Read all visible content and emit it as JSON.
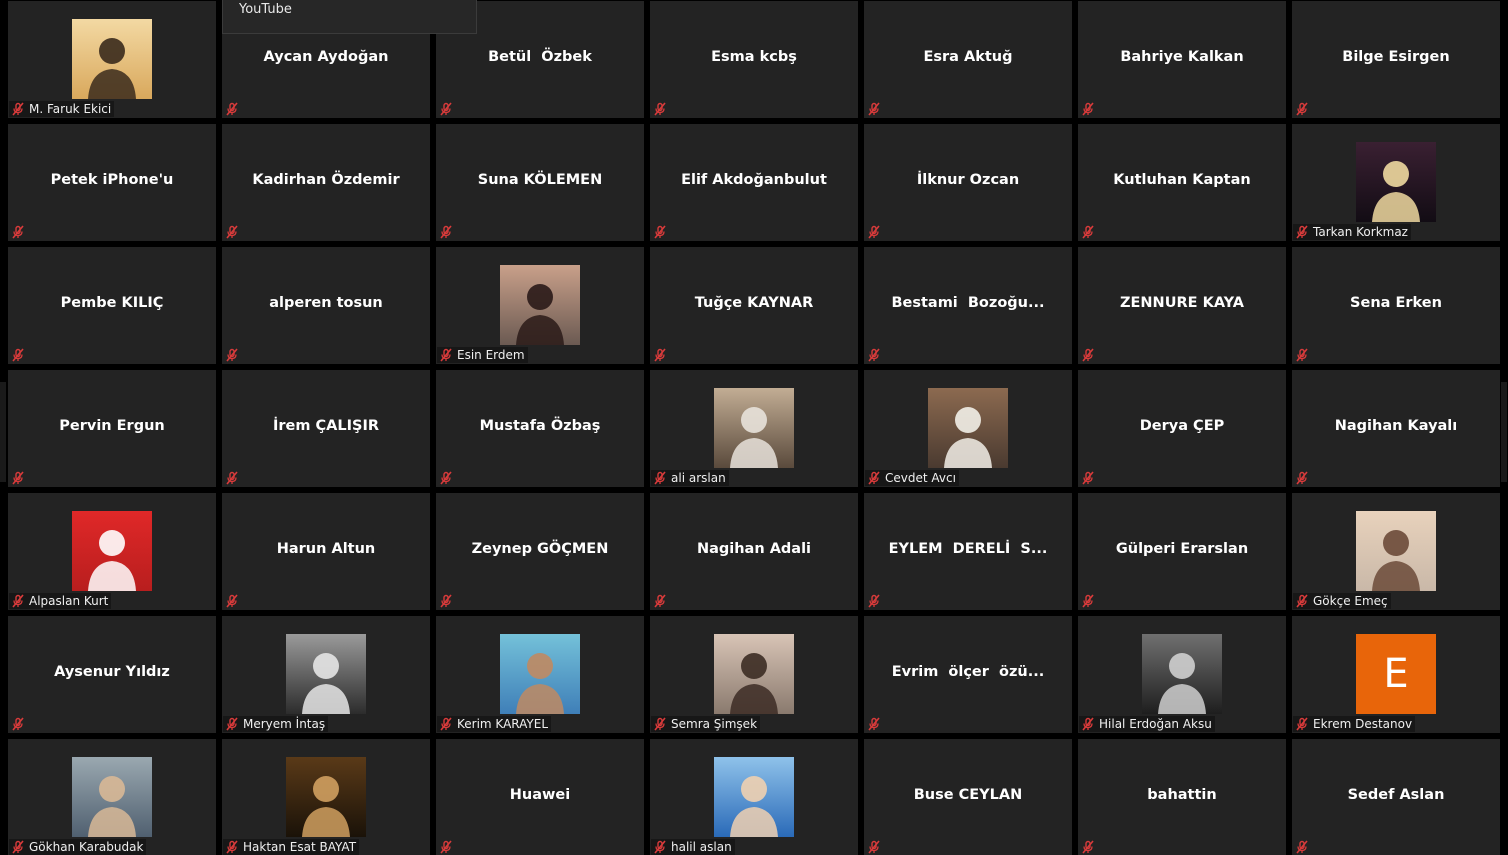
{
  "overlay_menu": {
    "label": "YouTube"
  },
  "colors": {
    "tile_background": "#232323",
    "stage_background": "#000000",
    "mute_icon": "#d93b3b",
    "name_text": "#ffffff"
  },
  "participants": [
    {
      "name": "M. Faruk Ekici",
      "avatar": "photo",
      "label": "M. Faruk Ekici"
    },
    {
      "name": "Aycan Aydoğan",
      "avatar": "none",
      "label": ""
    },
    {
      "name": "Betül  Özbek",
      "avatar": "none",
      "label": ""
    },
    {
      "name": "Esma kcbş",
      "avatar": "none",
      "label": ""
    },
    {
      "name": "Esra Aktuğ",
      "avatar": "none",
      "label": ""
    },
    {
      "name": "Bahriye Kalkan",
      "avatar": "none",
      "label": ""
    },
    {
      "name": "Bilge Esirgen",
      "avatar": "none",
      "label": ""
    },
    {
      "name": "Petek iPhone'u",
      "avatar": "none",
      "label": ""
    },
    {
      "name": "Kadirhan Özdemir",
      "avatar": "none",
      "label": ""
    },
    {
      "name": "Suna KÖLEMEN",
      "avatar": "none",
      "label": ""
    },
    {
      "name": "Elif Akdoğanbulut",
      "avatar": "none",
      "label": ""
    },
    {
      "name": "İlknur Ozcan",
      "avatar": "none",
      "label": ""
    },
    {
      "name": "Kutluhan Kaptan",
      "avatar": "none",
      "label": ""
    },
    {
      "name": "Tarkan Korkmaz",
      "avatar": "photo",
      "label": "Tarkan Korkmaz"
    },
    {
      "name": "Pembe KILIÇ",
      "avatar": "none",
      "label": ""
    },
    {
      "name": "alperen tosun",
      "avatar": "none",
      "label": ""
    },
    {
      "name": "Esin Erdem",
      "avatar": "photo",
      "label": "Esin Erdem"
    },
    {
      "name": "Tuğçe KAYNAR",
      "avatar": "none",
      "label": ""
    },
    {
      "name": "Bestami  Bozoğu...",
      "avatar": "none",
      "label": ""
    },
    {
      "name": "ZENNURE KAYA",
      "avatar": "none",
      "label": ""
    },
    {
      "name": "Sena Erken",
      "avatar": "none",
      "label": ""
    },
    {
      "name": "Pervin Ergun",
      "avatar": "none",
      "label": ""
    },
    {
      "name": "İrem ÇALIŞIR",
      "avatar": "none",
      "label": ""
    },
    {
      "name": "Mustafa Özbaş",
      "avatar": "none",
      "label": ""
    },
    {
      "name": "ali arslan",
      "avatar": "photo",
      "label": "ali arslan"
    },
    {
      "name": "Cevdet Avcı",
      "avatar": "photo",
      "label": "Cevdet Avcı"
    },
    {
      "name": "Derya ÇEP",
      "avatar": "none",
      "label": ""
    },
    {
      "name": "Nagihan Kayalı",
      "avatar": "none",
      "label": ""
    },
    {
      "name": "Alpaslan Kurt",
      "avatar": "photo",
      "label": "Alpaslan Kurt"
    },
    {
      "name": "Harun Altun",
      "avatar": "none",
      "label": ""
    },
    {
      "name": "Zeynep GÖÇMEN",
      "avatar": "none",
      "label": ""
    },
    {
      "name": "Nagihan Adali",
      "avatar": "none",
      "label": ""
    },
    {
      "name": "EYLEM  DERELİ  S...",
      "avatar": "none",
      "label": ""
    },
    {
      "name": "Gülperi Erarslan",
      "avatar": "none",
      "label": ""
    },
    {
      "name": "Gökçe Emeç",
      "avatar": "photo",
      "label": "Gökçe Emeç"
    },
    {
      "name": "Aysenur Yıldız",
      "avatar": "none",
      "label": ""
    },
    {
      "name": "Meryem İntaş",
      "avatar": "photo",
      "label": "Meryem İntaş"
    },
    {
      "name": "Kerim KARAYEL",
      "avatar": "photo",
      "label": "Kerim KARAYEL"
    },
    {
      "name": "Semra Şimşek",
      "avatar": "photo",
      "label": "Semra Şimşek"
    },
    {
      "name": "Evrim  ölçer  özü...",
      "avatar": "none",
      "label": ""
    },
    {
      "name": "Hilal Erdoğan Aksu",
      "avatar": "photo",
      "label": "Hilal Erdoğan Aksu"
    },
    {
      "name": "Ekrem Destanov",
      "avatar": "initial",
      "initial": "E",
      "initial_color": "#e8650a",
      "label": "Ekrem Destanov"
    },
    {
      "name": "Gökhan Karabudak",
      "avatar": "photo",
      "label": "Gökhan Karabudak"
    },
    {
      "name": "Haktan Esat BAYAT",
      "avatar": "photo",
      "label": "Haktan Esat BAYAT"
    },
    {
      "name": "Huawei",
      "avatar": "none",
      "label": ""
    },
    {
      "name": "halil aslan",
      "avatar": "photo",
      "label": "halil aslan"
    },
    {
      "name": "Buse CEYLAN",
      "avatar": "none",
      "label": ""
    },
    {
      "name": "bahattin",
      "avatar": "none",
      "label": ""
    },
    {
      "name": "Sedef Aslan",
      "avatar": "none",
      "label": ""
    }
  ]
}
